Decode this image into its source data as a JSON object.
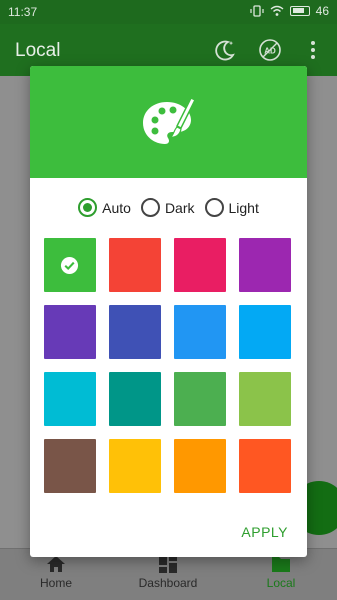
{
  "status_bar": {
    "time": "11:37",
    "battery": "46"
  },
  "app_bar": {
    "title": "Local",
    "icons": [
      "moon-icon",
      "ad-icon",
      "more-icon"
    ]
  },
  "dialog": {
    "header_icon": "palette-icon",
    "theme_modes": [
      {
        "label": "Auto",
        "selected": true
      },
      {
        "label": "Dark",
        "selected": false
      },
      {
        "label": "Light",
        "selected": false
      }
    ],
    "colors": [
      {
        "color": "#3dbd3d",
        "selected": true
      },
      {
        "color": "#f44336",
        "selected": false
      },
      {
        "color": "#e91e63",
        "selected": false
      },
      {
        "color": "#9c27b0",
        "selected": false
      },
      {
        "color": "#673ab7",
        "selected": false
      },
      {
        "color": "#3f51b5",
        "selected": false
      },
      {
        "color": "#2196f3",
        "selected": false
      },
      {
        "color": "#03a9f4",
        "selected": false
      },
      {
        "color": "#00bcd4",
        "selected": false
      },
      {
        "color": "#009688",
        "selected": false
      },
      {
        "color": "#4caf50",
        "selected": false
      },
      {
        "color": "#8bc34a",
        "selected": false
      },
      {
        "color": "#795548",
        "selected": false
      },
      {
        "color": "#ffc107",
        "selected": false
      },
      {
        "color": "#ff9800",
        "selected": false
      },
      {
        "color": "#ff5722",
        "selected": false
      }
    ],
    "apply_label": "APPLY"
  },
  "bottom_nav": {
    "items": [
      {
        "label": "Home",
        "icon": "home-icon"
      },
      {
        "label": "Dashboard",
        "icon": "dashboard-icon"
      },
      {
        "label": "Local",
        "icon": "folder-icon",
        "active": true
      }
    ]
  },
  "theme": {
    "primary": "#3dbd3d",
    "primary_dark": "#1f6f1f",
    "accent": "#2e9e2e"
  }
}
